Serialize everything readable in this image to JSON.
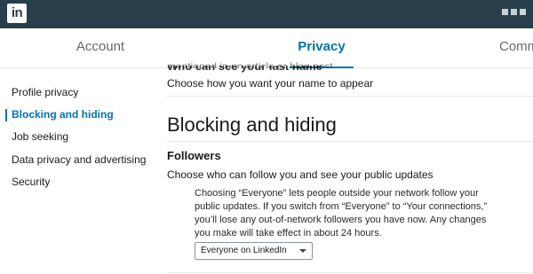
{
  "topbar": {
    "logo_text": "in"
  },
  "tabs": [
    {
      "label": "Account"
    },
    {
      "label": "Privacy"
    },
    {
      "label": "Comm"
    }
  ],
  "sidebar": {
    "items": [
      {
        "label": "Profile privacy"
      },
      {
        "label": "Blocking and hiding"
      },
      {
        "label": "Job seeking"
      },
      {
        "label": "Data privacy and advertising"
      },
      {
        "label": "Security"
      }
    ],
    "active_index": 1
  },
  "main": {
    "peek_text": "mentioned in an article or blog post",
    "prev_heading": "Who can see your last name",
    "prev_desc": "Choose how you want your name to appear",
    "section_title": "Blocking and hiding",
    "followers_title": "Followers",
    "followers_desc": "Choose who can follow you and see your public updates",
    "followers_info": "Choosing “Everyone” lets people outside your network follow your public updates. If you switch from “Everyone” to “Your connections,” you’ll lose any out-of-network followers you have now. Any changes you make will take effect in about 24 hours.",
    "followers_select_value": "Everyone on LinkedIn"
  },
  "colors": {
    "topbar": "#283e4a",
    "accent": "#0073b1"
  }
}
